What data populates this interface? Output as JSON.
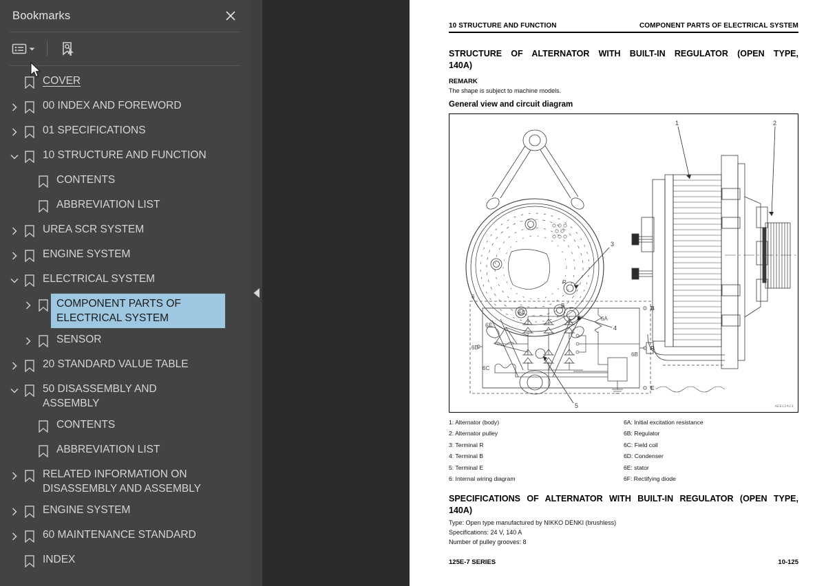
{
  "sidebar": {
    "title": "Bookmarks",
    "close_icon": "close-icon",
    "toolbar": {
      "list_view_icon": "list-view-icon",
      "caret_icon": "chevron-down-icon",
      "find_bookmark_icon": "find-bookmark-icon"
    },
    "items": [
      {
        "label": "COVER",
        "indent": 1,
        "twisty": "none",
        "selected": false,
        "underline": true
      },
      {
        "label": "00 INDEX AND FOREWORD",
        "indent": 0,
        "twisty": "collapsed",
        "selected": false,
        "underline": false
      },
      {
        "label": "01 SPECIFICATIONS",
        "indent": 0,
        "twisty": "collapsed",
        "selected": false,
        "underline": false
      },
      {
        "label": "10 STRUCTURE AND FUNCTION",
        "indent": 0,
        "twisty": "expanded",
        "selected": false,
        "underline": false
      },
      {
        "label": "CONTENTS",
        "indent": 2,
        "twisty": "none",
        "selected": false,
        "underline": false
      },
      {
        "label": "ABBREVIATION LIST",
        "indent": 2,
        "twisty": "none",
        "selected": false,
        "underline": false
      },
      {
        "label": "UREA SCR SYSTEM",
        "indent": 1,
        "twisty": "collapsed",
        "selected": false,
        "underline": false
      },
      {
        "label": "ENGINE SYSTEM",
        "indent": 1,
        "twisty": "collapsed",
        "selected": false,
        "underline": false
      },
      {
        "label": "ELECTRICAL SYSTEM",
        "indent": 1,
        "twisty": "expanded",
        "selected": false,
        "underline": false
      },
      {
        "label": "COMPONENT PARTS OF ELECTRICAL SYSTEM",
        "indent": 2,
        "twisty": "collapsed",
        "selected": true,
        "underline": false
      },
      {
        "label": "SENSOR",
        "indent": 2,
        "twisty": "collapsed",
        "selected": false,
        "underline": false
      },
      {
        "label": "20 STANDARD VALUE TABLE",
        "indent": 0,
        "twisty": "collapsed",
        "selected": false,
        "underline": false
      },
      {
        "label": "50 DISASSEMBLY AND ASSEMBLY",
        "indent": 0,
        "twisty": "expanded",
        "selected": false,
        "underline": false
      },
      {
        "label": "CONTENTS",
        "indent": 2,
        "twisty": "none",
        "selected": false,
        "underline": false
      },
      {
        "label": "ABBREVIATION LIST",
        "indent": 2,
        "twisty": "none",
        "selected": false,
        "underline": false
      },
      {
        "label": "RELATED INFORMATION ON DISASSEMBLY AND ASSEMBLY",
        "indent": 1,
        "twisty": "collapsed",
        "selected": false,
        "underline": false
      },
      {
        "label": "ENGINE SYSTEM",
        "indent": 1,
        "twisty": "collapsed",
        "selected": false,
        "underline": false
      },
      {
        "label": "60 MAINTENANCE STANDARD",
        "indent": 0,
        "twisty": "collapsed",
        "selected": false,
        "underline": false
      },
      {
        "label": "INDEX",
        "indent": 1,
        "twisty": "none",
        "selected": false,
        "underline": false
      }
    ]
  },
  "viewer": {
    "collapse_handle_icon": "triangle-left-icon",
    "cursor_icon": "mouse-pointer-icon"
  },
  "document": {
    "header_left": "10 STRUCTURE AND FUNCTION",
    "header_right": "COMPONENT PARTS OF ELECTRICAL SYSTEM",
    "section_title": "STRUCTURE OF ALTERNATOR WITH BUILT-IN REGULATOR (OPEN TYPE, 140A)",
    "remark_label": "REMARK",
    "remark_text": "The shape is subject to machine models.",
    "figure_subhead": "General view and circuit diagram",
    "figure_code": "AEE12423",
    "legend_left": [
      "1: Alternator (body)",
      "2: Alternator pulley",
      "3: Terminal R",
      "4: Terminal B",
      "5: Terminal E",
      "6: Internal wiring diagram"
    ],
    "legend_right": [
      "6A: Initial excitation resistance",
      "6B: Regulator",
      "6C: Field coil",
      "6D: Condenser",
      "6E: stator",
      "6F: Rectifying diode"
    ],
    "spec_title": "SPECIFICATIONS OF ALTERNATOR WITH BUILT-IN REGULATOR (OPEN TYPE, 140A)",
    "spec_lines": [
      "Type: Open type manufactured by NIKKO DENKI (brushless)",
      "Specifications: 24 V, 140 A",
      "Number of pulley grooves: 8"
    ],
    "footer_left": "125E-7 SERIES",
    "footer_right": "10-125",
    "figure_callouts": [
      "1",
      "2",
      "3",
      "4",
      "5",
      "6",
      "6A",
      "6B",
      "6C",
      "6D",
      "6E",
      "6F",
      "B",
      "R",
      "E"
    ]
  },
  "colors": {
    "sidebar_bg": "#434343",
    "viewer_bg": "#2b2b2b",
    "selection": "#9ec8e2",
    "text": "#d5d5d5",
    "page_bg": "#ffffff"
  }
}
